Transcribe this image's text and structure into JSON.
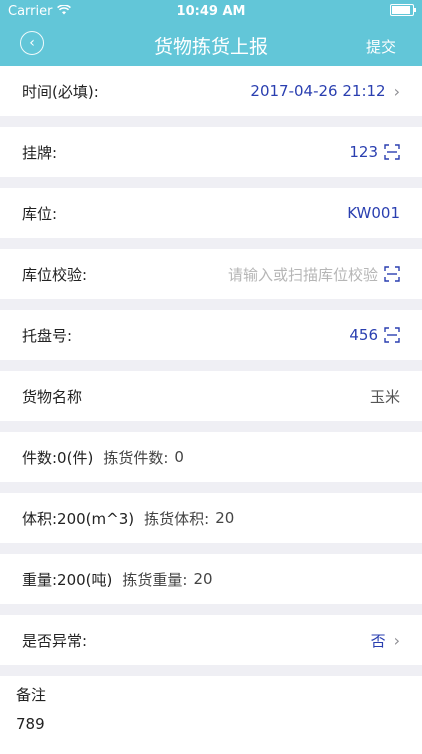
{
  "status_bar": {
    "carrier": "Carrier",
    "time": "10:49 AM"
  },
  "nav": {
    "title": "货物拣货上报",
    "action": "提交"
  },
  "rows": {
    "time": {
      "label": "时间(必填):",
      "value": "2017-04-26 21:12"
    },
    "tag": {
      "label": "挂牌:",
      "value": "123"
    },
    "location": {
      "label": "库位:",
      "value": "KW001"
    },
    "location_check": {
      "label": "库位校验:",
      "placeholder": "请输入或扫描库位校验"
    },
    "pallet": {
      "label": "托盘号:",
      "value": "456"
    },
    "goods_name": {
      "label": "货物名称",
      "value": "玉米"
    },
    "pieces": {
      "label": "件数:0(件)",
      "sub_label": "拣货件数:",
      "sub_value": "0"
    },
    "volume": {
      "label": "体积:200(m^3)",
      "sub_label": "拣货体积:",
      "sub_value": "20"
    },
    "weight": {
      "label": "重量:200(吨)",
      "sub_label": "拣货重量:",
      "sub_value": "20"
    },
    "abnormal": {
      "label": "是否异常:",
      "value": "否"
    }
  },
  "remark": {
    "label": "备注",
    "value": "789"
  },
  "colors": {
    "nav": "#62c6d8",
    "value": "#2a3fb0",
    "background": "#efeff4"
  }
}
